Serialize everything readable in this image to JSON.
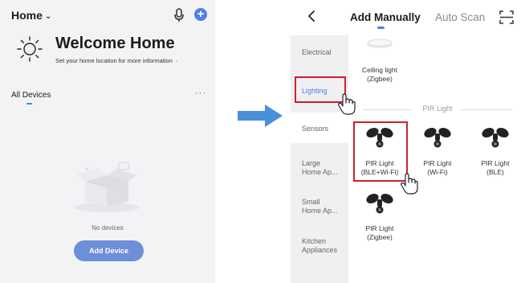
{
  "left_panel": {
    "home_title": "Home",
    "welcome_title": "Welcome Home",
    "welcome_subtitle": "Set your home location for more information",
    "devices_tab": "All Devices",
    "empty_text": "No devices",
    "add_device_label": "Add Device",
    "icons": [
      "microphone-icon",
      "plus-icon",
      "sun-icon",
      "more-icon",
      "empty-box-illustration"
    ]
  },
  "right_panel": {
    "tabs": [
      "Add Manually",
      "Auto Scan"
    ],
    "categories": [
      {
        "label": "Electrical",
        "active": false
      },
      {
        "label": "Lighting",
        "active": true
      },
      {
        "label": "Sensors",
        "active": false
      },
      {
        "label": "Large Home Ap...",
        "active": false
      },
      {
        "label": "Small Home Ap...",
        "active": false
      },
      {
        "label": "Kitchen Appliances",
        "active": false
      }
    ],
    "category_lines": [
      [
        "Electrical"
      ],
      [
        "Lighting"
      ],
      [
        "Sensors"
      ],
      [
        "Large",
        "Home Ap..."
      ],
      [
        "Small",
        "Home Ap..."
      ],
      [
        "Kitchen",
        "Appliances"
      ]
    ],
    "top_device": {
      "lines": [
        "Ceiling light",
        "(Zigbee)"
      ]
    },
    "section_title": "PIR Light",
    "devices": [
      {
        "lines": [
          "PIR Light",
          "(BLE+Wi-Fi)"
        ],
        "highlighted": true
      },
      {
        "lines": [
          "PIR Light",
          "(Wi-Fi)"
        ],
        "highlighted": false
      },
      {
        "lines": [
          "PIR Light",
          "(BLE)"
        ],
        "highlighted": false
      },
      {
        "lines": [
          "PIR Light",
          "(Zigbee)"
        ],
        "highlighted": false
      }
    ],
    "icons": [
      "back-chevron-icon",
      "scan-icon",
      "ceiling-light-icon",
      "pir-light-icon",
      "hand-pointer-icon"
    ]
  },
  "colors": {
    "accent": "#4f7fe6",
    "add_button": "#6d8fd9",
    "highlight_box": "#d01f26",
    "arrow": "#4a90d9"
  }
}
